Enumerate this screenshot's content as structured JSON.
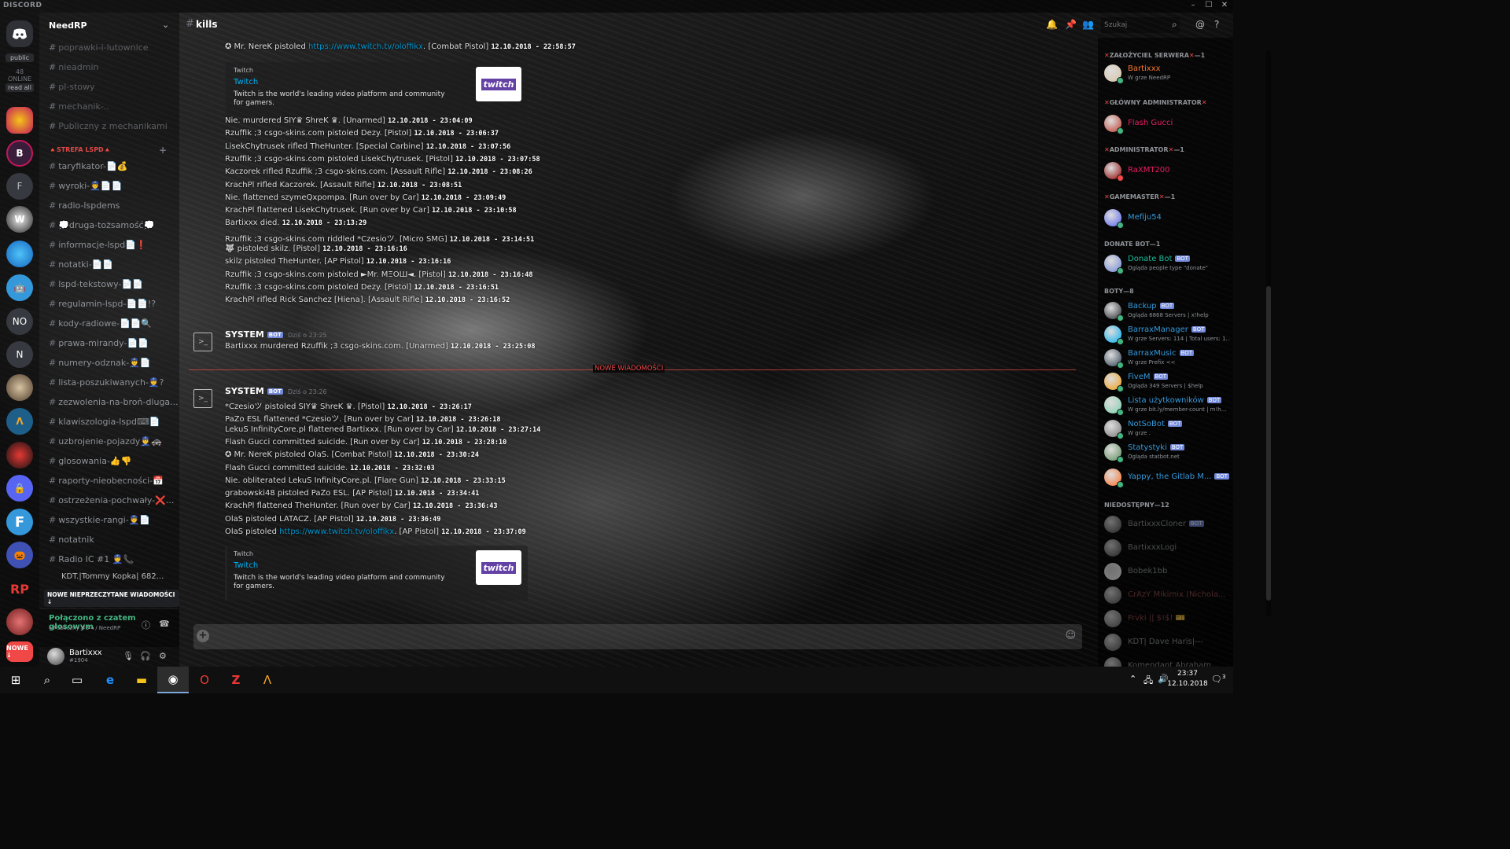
{
  "app": {
    "brand": "DISCORD"
  },
  "window_controls": [
    "–",
    "☐",
    "✕"
  ],
  "servers": {
    "pills": [
      "public",
      "48 ONLINE",
      "read all"
    ],
    "letters": [
      "F",
      "NO",
      "N"
    ],
    "badge": "NOWE ↓",
    "rp_logo": "RP"
  },
  "sidebar": {
    "guild_name": "NeedRP",
    "channels": [
      {
        "label": "poprawki-i-lutownice",
        "dim": true
      },
      {
        "label": "nieadmin",
        "dim": true
      },
      {
        "label": "pl-stowy",
        "dim": true
      },
      {
        "label": "mechanik-..",
        "dim": true
      },
      {
        "label": "Publiczny z mechanikami",
        "dim": true
      },
      {
        "label": "🔺STREFA LSPD🔺",
        "cat": true
      },
      {
        "label": "taryfikator-📄💰"
      },
      {
        "label": "wyroki-👮📄📄"
      },
      {
        "label": "radio-lspdems"
      },
      {
        "label": "💭druga-tożsamość💭"
      },
      {
        "label": "informacje-lspd📄❗"
      },
      {
        "label": "notatki-📄📄"
      },
      {
        "label": "lspd-tekstowy-📄📄"
      },
      {
        "label": "regulamin-lspd-📄📄!?"
      },
      {
        "label": "kody-radiowe-📄📄🔍"
      },
      {
        "label": "prawa-mirandy-📄📄"
      },
      {
        "label": "numery-odznak-👮📄"
      },
      {
        "label": "lista-poszukiwanych-👮?"
      },
      {
        "label": "zezwolenia-na-broń-dluga..."
      },
      {
        "label": "klawiszologia-lspd⌨📄"
      },
      {
        "label": "uzbrojenie-pojazdy👮🚓"
      },
      {
        "label": "glosowania-👍👎"
      },
      {
        "label": "raporty-nieobecności-📅"
      },
      {
        "label": "ostrzeżenia-pochwały-❌..."
      },
      {
        "label": "wszystkie-rangi-👮📄"
      },
      {
        "label": "notatnik"
      },
      {
        "label": "Radio IC #1 👮📞"
      }
    ],
    "voice_user": "KDT.|Tommy Kopka| 682...",
    "unread_banner": "NOWE NIEPRZECZYTANE WIADOMOŚCI ↓",
    "voice_panel": {
      "title": "Połączono z czatem głosowym",
      "subtitle": "◂ Publiczny #3 ◂ / NeedRP"
    },
    "user": {
      "name": "Bartixxx",
      "tag": "#1904"
    }
  },
  "header": {
    "channel": "kills",
    "search_placeholder": "Szukaj"
  },
  "messages": {
    "group1": [
      {
        "text": "✪ Mr. NereK pistoled ",
        "link": "https://www.twitch.tv/oloffikx",
        "after": ". [Combat Pistol]",
        "ts": "12.10.2018 - 22:58:57"
      },
      {
        "text": "Nie. murdered SIY♛ ShreK ♛. [Unarmed]",
        "ts": "12.10.2018 - 23:04:09"
      },
      {
        "text": "Rzuffik ;3 csgo-skins.com pistoled Dezy. [Pistol]",
        "ts": "12.10.2018 - 23:06:37"
      },
      {
        "text": "LisekChytrusek rifled TheHunter. [Special Carbine]",
        "ts": "12.10.2018 - 23:07:56"
      },
      {
        "text": "Rzuffik ;3 csgo-skins.com pistoled LisekChytrusek. [Pistol]",
        "ts": "12.10.2018 - 23:07:58"
      },
      {
        "text": "Kaczorek rifled Rzuffik ;3 csgo-skins.com. [Assault Rifle]",
        "ts": "12.10.2018 - 23:08:26"
      },
      {
        "text": "KrachPl rifled Kaczorek. [Assault Rifle]",
        "ts": "12.10.2018 - 23:08:51"
      },
      {
        "text": "Nie. flattened szymeQxpompa. [Run over by Car]",
        "ts": "12.10.2018 - 23:09:49"
      },
      {
        "text": "KrachPl flattened LisekChytrusek. [Run over by Car]",
        "ts": "12.10.2018 - 23:10:58"
      },
      {
        "text": "Bartixxx died.",
        "ts": "12.10.2018 - 23:13:29"
      },
      {
        "text": "Rzuffik ;3 csgo-skins.com riddled *Czesioツ. [Micro SMG]",
        "ts": "12.10.2018 - 23:14:51"
      },
      {
        "text": "🐺 pistoled skilz. [Pistol]",
        "ts": "12.10.2018 - 23:16:16"
      },
      {
        "text": "skilz pistoled TheHunter. [AP Pistol]",
        "ts": "12.10.2018 - 23:16:16"
      },
      {
        "text": "Rzuffik ;3 csgo-skins.com pistoled ►Mr. MΞOШ◄. [Pistol]",
        "ts": "12.10.2018 - 23:16:48"
      },
      {
        "text": "Rzuffik ;3 csgo-skins.com pistoled Dezy. [Pistol]",
        "ts": "12.10.2018 - 23:16:51"
      },
      {
        "text": "KrachPl rifled Rick Sanchez [Hiena]. [Assault Rifle]",
        "ts": "12.10.2018 - 23:16:52"
      }
    ],
    "system1": {
      "author": "SYSTEM",
      "bot": "BOT",
      "time": "Dziś o 23:25",
      "text": "Bartixxx murdered Rzuffik ;3 csgo-skins.com. [Unarmed]",
      "ts": "12.10.2018 - 23:25:08"
    },
    "new_label": "NOWE WIADOMOŚCI",
    "system2": {
      "author": "SYSTEM",
      "bot": "BOT",
      "time": "Dziś o 23:26"
    },
    "group2": [
      {
        "text": "*Czesioツ pistoled SIY♛ ShreK ♛. [Pistol]",
        "ts": "12.10.2018 - 23:26:17"
      },
      {
        "text": "PaZo ESL flattened *Czesioツ. [Run over by Car]",
        "ts": "12.10.2018 - 23:26:18"
      },
      {
        "text": "LekuS InfinityCore.pl flattened Bartixxx. [Run over by Car]",
        "ts": "12.10.2018 - 23:27:14"
      },
      {
        "text": "Flash Gucci committed suicide. [Run over by Car]",
        "ts": "12.10.2018 - 23:28:10"
      },
      {
        "text": "✪ Mr. NereK pistoled OlaS. [Combat Pistol]",
        "ts": "12.10.2018 - 23:30:24"
      },
      {
        "text": "Flash Gucci committed suicide.",
        "ts": "12.10.2018 - 23:32:03"
      },
      {
        "text": "Nie. obliterated LekuS InfinityCore.pl. [Flare Gun]",
        "ts": "12.10.2018 - 23:33:15"
      },
      {
        "text": "grabowski48 pistoled PaZo ESL. [AP Pistol]",
        "ts": "12.10.2018 - 23:34:41"
      },
      {
        "text": "KrachPl flattened TheHunter. [Run over by Car]",
        "ts": "12.10.2018 - 23:36:43"
      },
      {
        "text": "OlaS pistoled LATACZ. [AP Pistol]",
        "ts": "12.10.2018 - 23:36:49"
      },
      {
        "text": "OlaS pistoled ",
        "link": "https://www.twitch.tv/oloffikx",
        "after": ". [AP Pistol]",
        "ts": "12.10.2018 - 23:37:09"
      }
    ],
    "embed": {
      "provider": "Twitch",
      "title": "Twitch",
      "description": "Twitch is the world's leading video platform and community for gamers.",
      "logo": "twitch"
    }
  },
  "members": {
    "groups": [
      {
        "label": "ZAŁOŻYCIEL SERWERA",
        "count": "—1",
        "x": true
      },
      {
        "label": "GŁÓWNY ADMINISTRATOR",
        "count": "",
        "x": true
      },
      {
        "label": "ADMINISTRATOR",
        "count": "—1",
        "x": true
      },
      {
        "label": "GAMEMASTER",
        "count": "—1",
        "x": true
      },
      {
        "label": "DONATE BOT—1",
        "count": "",
        "x": false
      },
      {
        "label": "BOTY—8",
        "count": "",
        "x": false
      },
      {
        "label": "NIEDOSTĘPNY—12",
        "count": "",
        "x": false
      }
    ],
    "list": [
      {
        "name": "Bartixxx",
        "activity": "W grze NeedRP",
        "color": "#f57731",
        "status": "#43b581",
        "bot": false
      },
      {
        "name": "Flash Gucci",
        "activity": "",
        "color": "#e91e63",
        "status": "#43b581",
        "bot": false
      },
      {
        "name": "RaXMT200",
        "activity": "",
        "color": "#e91e63",
        "status": "#f04747",
        "bot": false
      },
      {
        "name": "Mefiju54",
        "activity": "",
        "color": "#3498db",
        "status": "#43b581",
        "bot": false
      },
      {
        "name": "Donate Bot",
        "activity": "Ogląda people type \"donate\"",
        "color": "#1abc9c",
        "status": "#43b581",
        "bot": true
      },
      {
        "name": "Backup",
        "activity": "Ogląda 6868 Servers | x!help",
        "color": "#3498db",
        "status": "#43b581",
        "bot": true
      },
      {
        "name": "BarraxManager",
        "activity": "W grze Servers: 114 | Total users: 1...",
        "color": "#3498db",
        "status": "#43b581",
        "bot": true
      },
      {
        "name": "BarraxMusic",
        "activity": "W grze Prefix <<",
        "color": "#3498db",
        "status": "#43b581",
        "bot": true
      },
      {
        "name": "FiveM",
        "activity": "Ogląda 349 Servers | $help",
        "color": "#3498db",
        "status": "#43b581",
        "bot": true
      },
      {
        "name": "Lista użytkowników",
        "activity": "W grze bit.ly/member-count | m!h...",
        "color": "#3498db",
        "status": "#43b581",
        "bot": true
      },
      {
        "name": "NotSoBot",
        "activity": "W grze .",
        "color": "#3498db",
        "status": "#43b581",
        "bot": true
      },
      {
        "name": "Statystyki",
        "activity": "Ogląda statbot.net",
        "color": "#3498db",
        "status": "#43b581",
        "bot": true
      },
      {
        "name": "Yappy, the Gitlab M...",
        "activity": "",
        "color": "#3498db",
        "status": "#43b581",
        "bot": true
      },
      {
        "name": "BartixxxCloner",
        "activity": "",
        "color": "#8e9297",
        "status": "",
        "bot": true
      },
      {
        "name": "BartixxxLogi",
        "activity": "",
        "color": "#8e9297",
        "status": "",
        "bot": false
      },
      {
        "name": "Bobek1bb",
        "activity": "",
        "color": "#8e9297",
        "status": "",
        "bot": false
      },
      {
        "name": "CrAzY Mikimix (Nichola...",
        "activity": "",
        "color": "#8e4a4a",
        "status": "",
        "bot": false
      },
      {
        "name": "Frvki || $!$! 🎫",
        "activity": "",
        "color": "#8e4a4a",
        "status": "",
        "bot": false
      },
      {
        "name": "KDT| Dave Haris|---",
        "activity": "",
        "color": "#8e9297",
        "status": "",
        "bot": false
      },
      {
        "name": "Komendant Abraham...",
        "activity": "",
        "color": "#8e9297",
        "status": "",
        "bot": false
      }
    ]
  },
  "taskbar": {
    "time": "23:37",
    "date": "12.10.2018",
    "notif": "3"
  }
}
